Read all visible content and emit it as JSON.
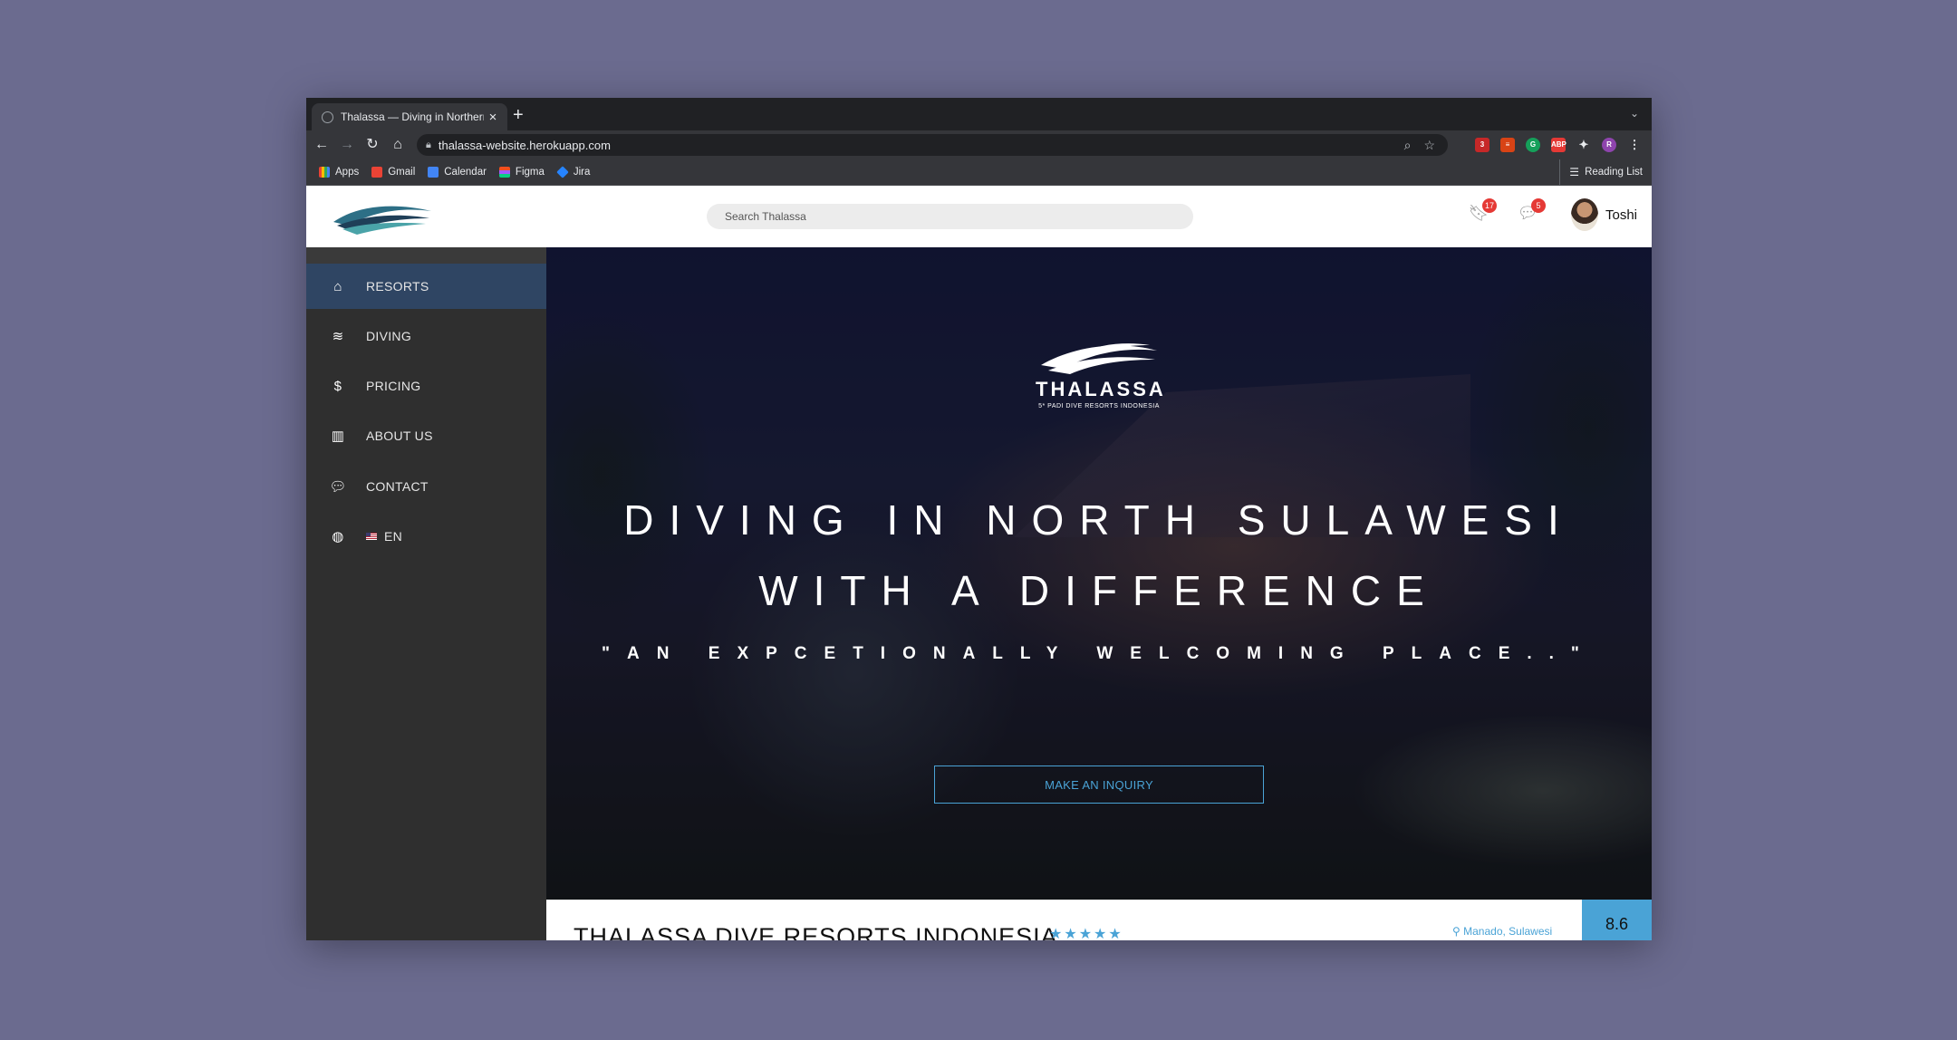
{
  "browser": {
    "tab_title": "Thalassa — Diving in Northern",
    "url": "thalassa-website.herokuapp.com",
    "bookmarks": [
      "Apps",
      "Gmail",
      "Calendar",
      "Figma",
      "Jira"
    ],
    "reading_list": "Reading List",
    "extension_badge": "3",
    "profile_initial": "R"
  },
  "header": {
    "search_placeholder": "Search Thalassa",
    "bookmark_count": "17",
    "message_count": "5",
    "user_name": "Toshi"
  },
  "sidebar": {
    "items": [
      {
        "label": "RESORTS",
        "icon": "home-icon"
      },
      {
        "label": "DIVING",
        "icon": "waves-icon"
      },
      {
        "label": "PRICING",
        "icon": "dollar-icon"
      },
      {
        "label": "ABOUT US",
        "icon": "map-icon"
      },
      {
        "label": "CONTACT",
        "icon": "chat-icon"
      },
      {
        "label": "EN",
        "icon": "globe-icon"
      }
    ]
  },
  "hero": {
    "brand": "THALASSA",
    "brand_sub": "5* PADI DIVE RESORTS INDONESIA",
    "headline_1": "DIVING IN NORTH SULAWESI",
    "headline_2": "WITH A DIFFERENCE",
    "quote": "\"AN EXPCETIONALLY WELCOMING PLACE..\"",
    "cta": "MAKE AN INQUIRY"
  },
  "resort": {
    "name": "THALASSA DIVE RESORTS INDONESIA",
    "stars": "★★★★★",
    "location": "Manado, Sulawesi",
    "score": "8.6"
  },
  "colors": {
    "accent": "#4aa3d6",
    "sidebar_bg": "#2f2f2f",
    "sidebar_active": "#2f4563",
    "badge": "#e53935"
  }
}
